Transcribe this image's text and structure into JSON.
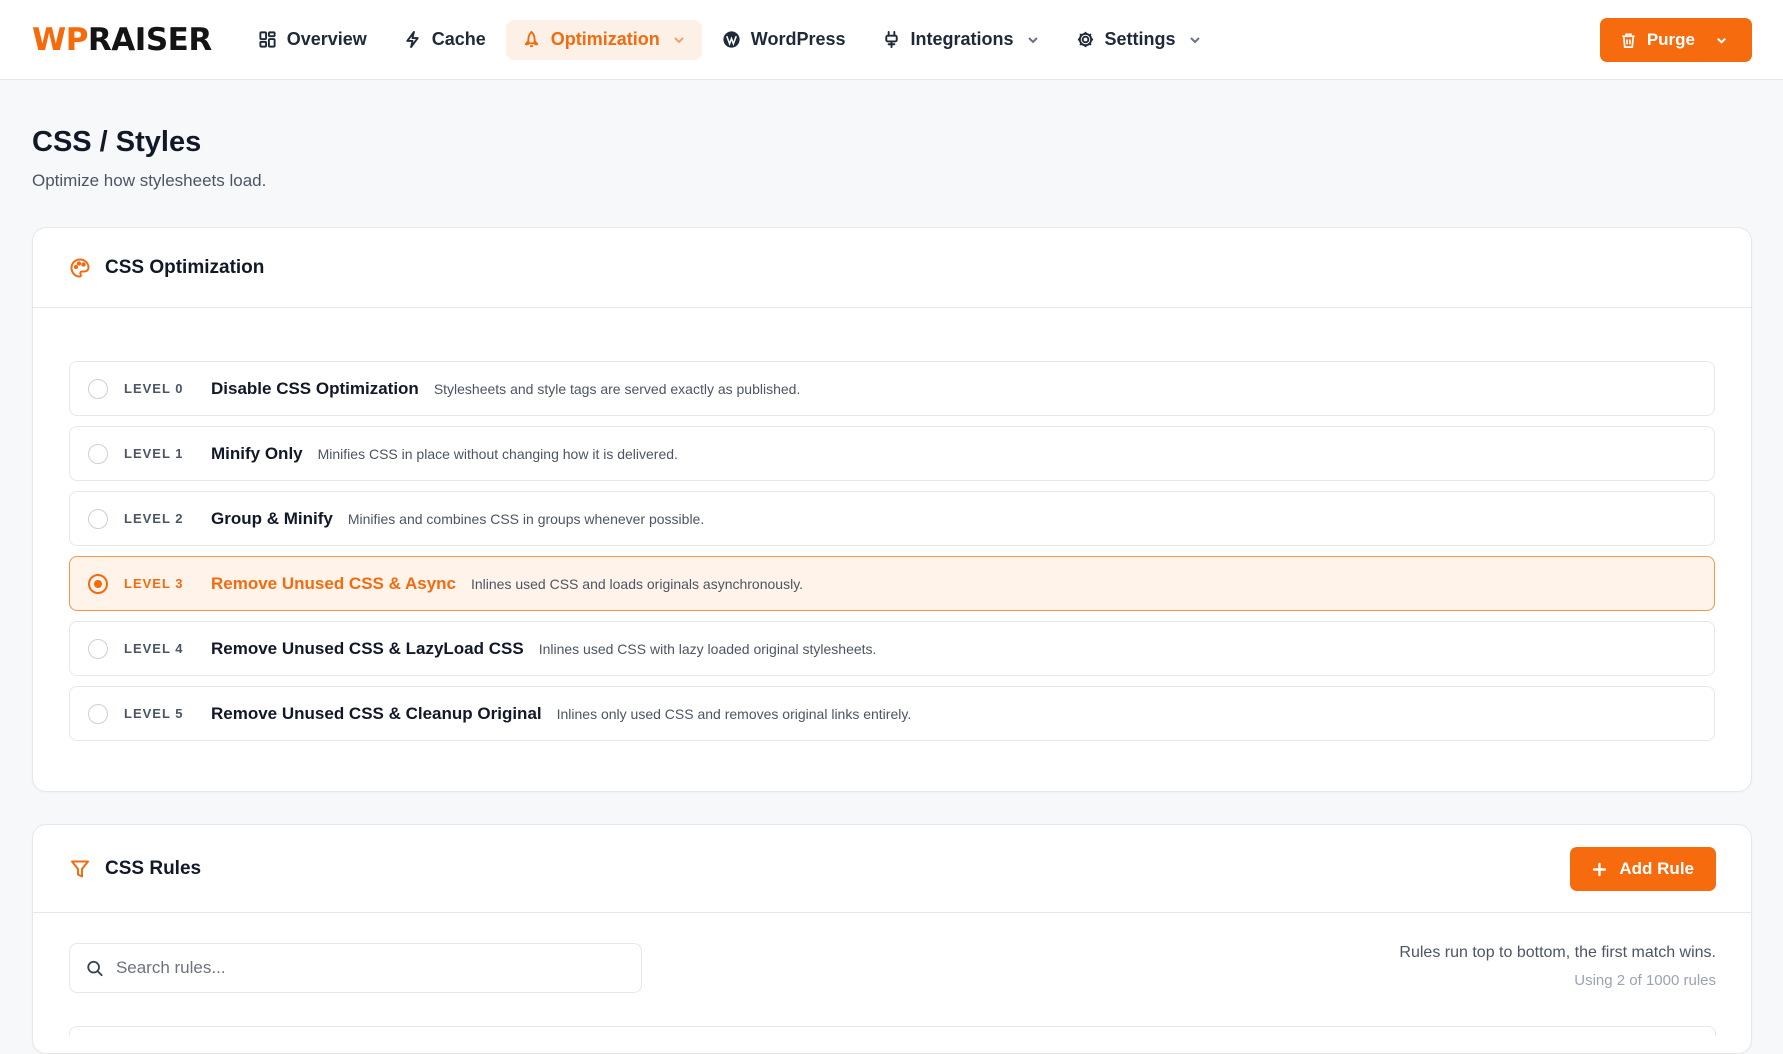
{
  "brand": {
    "part1": "WP",
    "part2": "RAISER",
    "accent": "#f66a0a"
  },
  "nav": {
    "items": [
      {
        "label": "Overview",
        "icon": "dashboard-icon"
      },
      {
        "label": "Cache",
        "icon": "bolt-icon"
      },
      {
        "label": "Optimization",
        "icon": "rocket-icon",
        "active": true,
        "dropdown": true
      },
      {
        "label": "WordPress",
        "icon": "wordpress-icon"
      },
      {
        "label": "Integrations",
        "icon": "plug-icon",
        "dropdown": true
      },
      {
        "label": "Settings",
        "icon": "gear-icon",
        "dropdown": true
      }
    ],
    "purge_label": "Purge"
  },
  "page": {
    "title": "CSS / Styles",
    "subtitle": "Optimize how stylesheets load."
  },
  "css_optimization": {
    "title": "CSS Optimization",
    "icon": "palette-icon",
    "selected_level": 3,
    "levels": [
      {
        "tag": "LEVEL 0",
        "name": "Disable CSS Optimization",
        "desc": "Stylesheets and style tags are served exactly as published."
      },
      {
        "tag": "LEVEL 1",
        "name": "Minify Only",
        "desc": "Minifies CSS in place without changing how it is delivered."
      },
      {
        "tag": "LEVEL 2",
        "name": "Group & Minify",
        "desc": "Minifies and combines CSS in groups whenever possible."
      },
      {
        "tag": "LEVEL 3",
        "name": "Remove Unused CSS & Async",
        "desc": "Inlines used CSS and loads originals asynchronously."
      },
      {
        "tag": "LEVEL 4",
        "name": "Remove Unused CSS & LazyLoad CSS",
        "desc": "Inlines used CSS with lazy loaded original stylesheets."
      },
      {
        "tag": "LEVEL 5",
        "name": "Remove Unused CSS & Cleanup Original",
        "desc": "Inlines only used CSS and removes original links entirely."
      }
    ]
  },
  "css_rules": {
    "title": "CSS Rules",
    "icon": "filter-icon",
    "add_label": "Add Rule",
    "search_placeholder": "Search rules...",
    "note": "Rules run top to bottom, the first match wins.",
    "count": "Using 2 of 1000 rules"
  }
}
